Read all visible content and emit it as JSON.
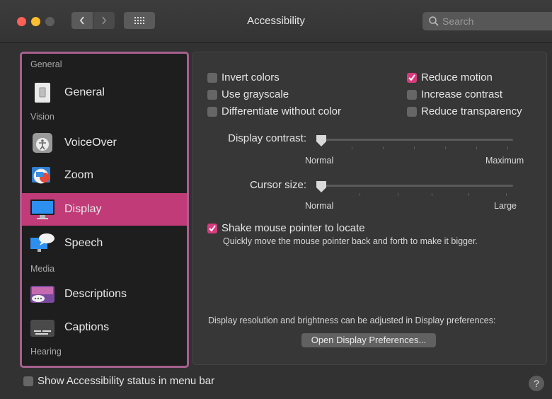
{
  "window": {
    "title": "Accessibility"
  },
  "search": {
    "placeholder": "Search"
  },
  "sidebar": {
    "categories": [
      "General",
      "Vision",
      "Media",
      "Hearing"
    ],
    "items": [
      {
        "label": "General",
        "icon": "switch-icon"
      },
      {
        "label": "VoiceOver",
        "icon": "voiceover-icon"
      },
      {
        "label": "Zoom",
        "icon": "zoom-icon"
      },
      {
        "label": "Display",
        "icon": "display-icon",
        "selected": true
      },
      {
        "label": "Speech",
        "icon": "speech-icon"
      },
      {
        "label": "Descriptions",
        "icon": "descriptions-icon"
      },
      {
        "label": "Captions",
        "icon": "captions-icon"
      }
    ]
  },
  "display": {
    "checkboxes": [
      {
        "label": "Invert colors",
        "checked": false
      },
      {
        "label": "Use grayscale",
        "checked": false
      },
      {
        "label": "Differentiate without color",
        "checked": false
      },
      {
        "label": "Reduce motion",
        "checked": true
      },
      {
        "label": "Increase contrast",
        "checked": false
      },
      {
        "label": "Reduce transparency",
        "checked": false
      }
    ],
    "contrast": {
      "label": "Display contrast:",
      "min_label": "Normal",
      "max_label": "Maximum",
      "value": 0
    },
    "cursor": {
      "label": "Cursor size:",
      "min_label": "Normal",
      "max_label": "Large",
      "value": 0
    },
    "shake": {
      "label": "Shake mouse pointer to locate",
      "checked": true,
      "description": "Quickly move the mouse pointer back and forth to make it bigger."
    },
    "resolution_note": "Display resolution and brightness can be adjusted in Display preferences:",
    "open_button": "Open Display Preferences..."
  },
  "footer": {
    "status_label": "Show Accessibility status in menu bar",
    "status_checked": false,
    "help": "?"
  },
  "colors": {
    "accent": "#c03b78",
    "checkbox_on": "#d83b7d",
    "sidebar_border": "#a6608f"
  }
}
